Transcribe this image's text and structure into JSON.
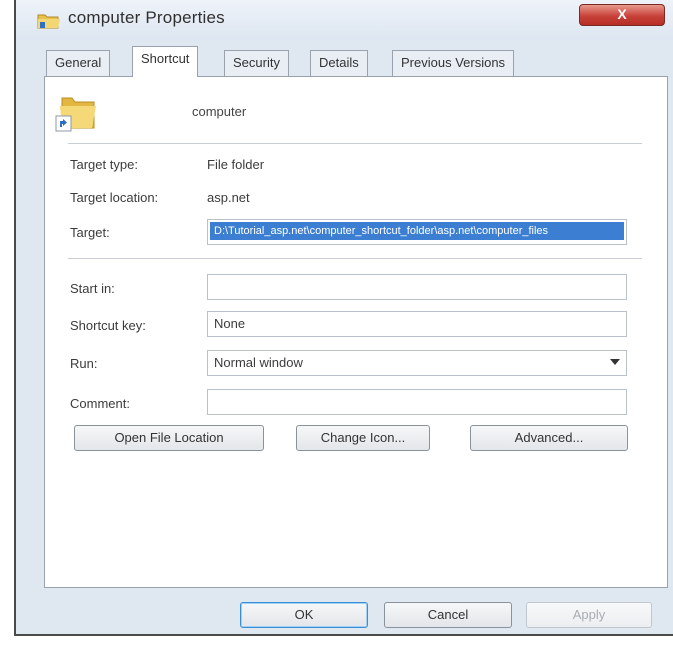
{
  "window": {
    "title": "computer Properties",
    "close_label": "X"
  },
  "tabs": [
    {
      "label": "General"
    },
    {
      "label": "Shortcut",
      "active": true
    },
    {
      "label": "Security"
    },
    {
      "label": "Details"
    },
    {
      "label": "Previous Versions"
    }
  ],
  "shortcut": {
    "name": "computer"
  },
  "fields": {
    "target_type": {
      "label": "Target type:",
      "value": "File folder"
    },
    "target_location": {
      "label": "Target location:",
      "value": "asp.net"
    },
    "target": {
      "label": "Target:",
      "value": "D:\\Tutorial_asp.net\\computer_shortcut_folder\\asp.net\\computer_files"
    },
    "start_in": {
      "label": "Start in:",
      "value": ""
    },
    "shortcut_key": {
      "label": "Shortcut key:",
      "value": "None"
    },
    "run": {
      "label": "Run:",
      "value": "Normal window"
    },
    "comment": {
      "label": "Comment:",
      "value": ""
    }
  },
  "buttons": {
    "open_file_location": "Open File Location",
    "change_icon": "Change Icon...",
    "advanced": "Advanced...",
    "ok": "OK",
    "cancel": "Cancel",
    "apply": "Apply"
  },
  "colors": {
    "selection": "#3c7fd2",
    "close_button": "#c8423a",
    "dialog_background": "#dfe7f1"
  },
  "icons": {
    "title": "folder-shortcut-icon",
    "shortcut": "folder-icon",
    "shortcut_overlay": "shortcut-arrow-icon",
    "dropdown": "chevron-down-icon"
  }
}
